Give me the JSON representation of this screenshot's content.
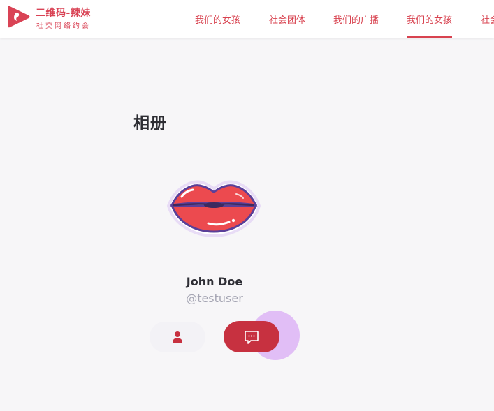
{
  "brand": {
    "title": "二维码-辣妹",
    "subtitle": "社交网络约会",
    "accent_color": "#d94355"
  },
  "nav": {
    "items": [
      {
        "label": "我们的女孩"
      },
      {
        "label": "社会团体"
      },
      {
        "label": "我们的广播"
      },
      {
        "label": "我们的女孩",
        "active": true
      },
      {
        "label": "社会团体"
      }
    ]
  },
  "page": {
    "title": "相册"
  },
  "profile": {
    "name": "John Doe",
    "handle": "@testuser",
    "avatar_icon": "lips-icon"
  },
  "actions": {
    "profile_icon": "user-icon",
    "message_icon": "message-icon"
  }
}
